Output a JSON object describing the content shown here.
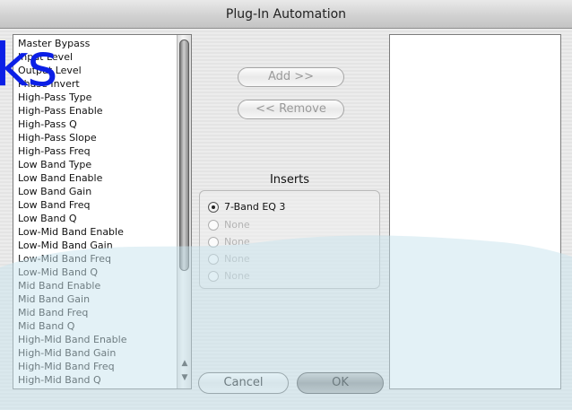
{
  "window": {
    "title": "Plug-In Automation"
  },
  "parameters": [
    "Master Bypass",
    "Input Level",
    "Output Level",
    "Phase Invert",
    "High-Pass Type",
    "High-Pass Enable",
    "High-Pass Q",
    "High-Pass Slope",
    "High-Pass Freq",
    "Low Band Type",
    "Low Band Enable",
    "Low Band Gain",
    "Low Band Freq",
    "Low Band Q",
    "Low-Mid Band Enable",
    "Low-Mid Band Gain",
    "Low-Mid Band Freq",
    "Low-Mid Band Q",
    "Mid Band Enable",
    "Mid Band Gain",
    "Mid Band Freq",
    "Mid Band Q",
    "High-Mid Band Enable",
    "High-Mid Band Gain",
    "High-Mid Band Freq",
    "High-Mid Band Q"
  ],
  "buttons": {
    "add": "Add >>",
    "remove": "<< Remove",
    "cancel": "Cancel",
    "ok": "OK"
  },
  "inserts": {
    "title": "Inserts",
    "options": [
      {
        "label": "7-Band EQ 3",
        "selected": true,
        "enabled": true
      },
      {
        "label": "None",
        "selected": false,
        "enabled": false
      },
      {
        "label": "None",
        "selected": false,
        "enabled": false
      },
      {
        "label": "None",
        "selected": false,
        "enabled": false
      },
      {
        "label": "None",
        "selected": false,
        "enabled": false
      }
    ]
  },
  "icons": {
    "scroll_up": "scroll-up-arrow-icon",
    "scroll_down": "scroll-down-arrow-icon"
  },
  "watermark": {
    "text": "ks",
    "color": "#0b1fe6"
  },
  "colors": {
    "overlay_wave": "#cfe6ef"
  }
}
